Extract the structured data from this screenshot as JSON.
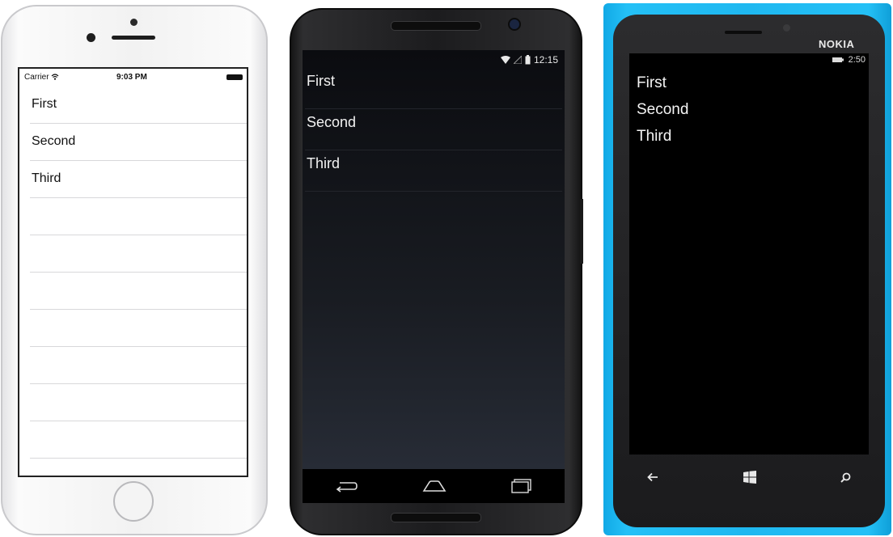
{
  "ios": {
    "carrier": "Carrier",
    "time": "9:03 PM",
    "items": [
      "First",
      "Second",
      "Third"
    ],
    "empty_rows": 7
  },
  "android": {
    "time": "12:15",
    "items": [
      "First",
      "Second",
      "Third"
    ]
  },
  "windows_phone": {
    "brand": "NOKIA",
    "time": "2:50",
    "items": [
      "First",
      "Second",
      "Third"
    ]
  },
  "colors": {
    "nokia_body": "#1fb8f0",
    "ios_divider": "#d8d8da",
    "android_bg_top": "#0b0c10",
    "android_bg_bottom": "#2a2f3a"
  },
  "icons": {
    "ios": [
      "wifi-icon",
      "battery-icon"
    ],
    "android": [
      "wifi-icon",
      "signal-icon",
      "battery-icon",
      "back-icon",
      "home-icon",
      "recents-icon"
    ],
    "windows_phone": [
      "battery-icon",
      "back-icon",
      "windows-start-icon",
      "search-icon"
    ]
  }
}
